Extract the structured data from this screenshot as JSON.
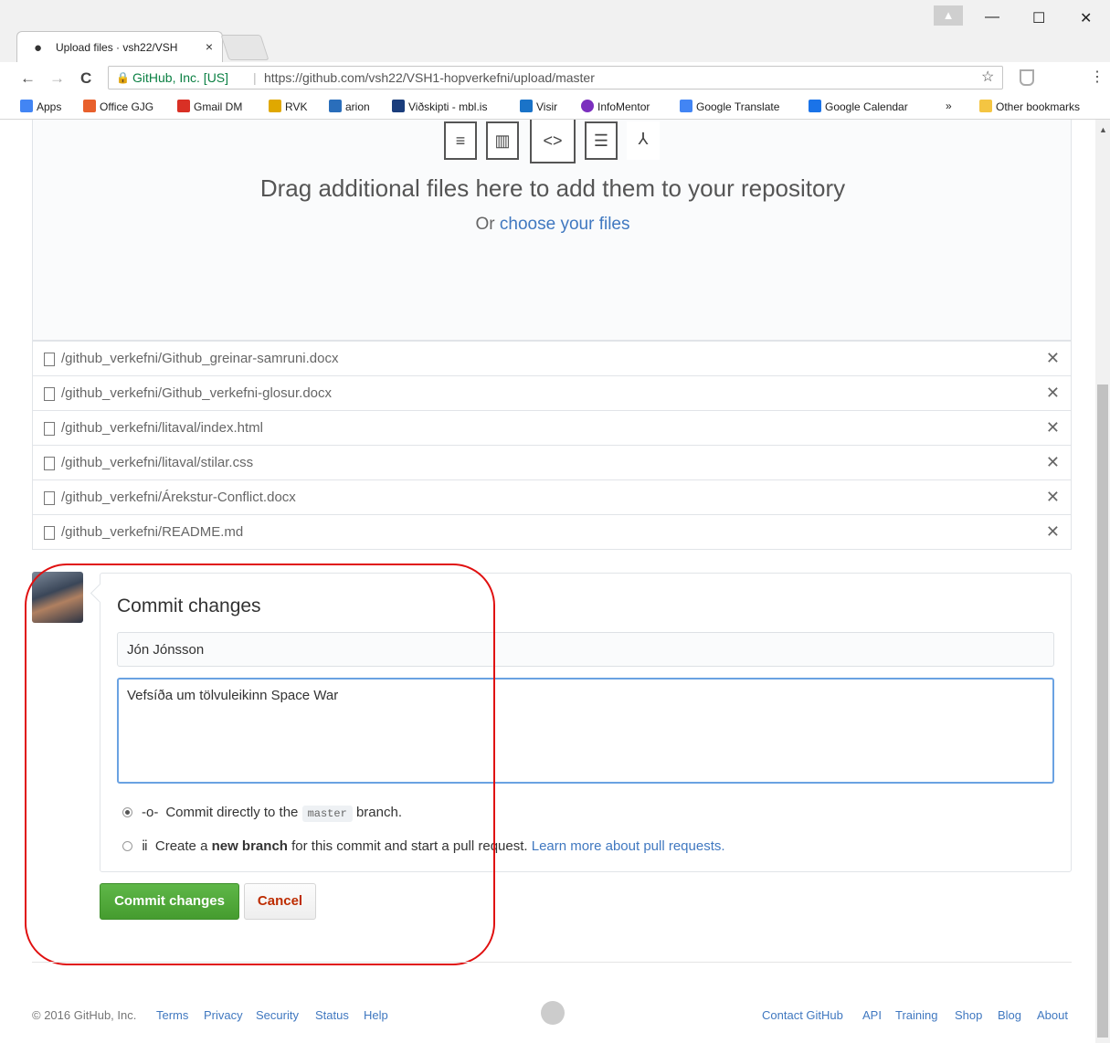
{
  "browser": {
    "tab_title": "Upload files · vsh22/VSH",
    "tab_close": "×",
    "org_label": "GitHub, Inc. [US]",
    "url": "https://github.com/vsh22/VSH1-hopverkefni/upload/master",
    "window_minimize": "—",
    "window_maximize": "☐",
    "window_close": "✕",
    "back": "←",
    "forward": "→",
    "reload": "C",
    "star": "☆",
    "menu": "⋮"
  },
  "bookmarks": {
    "items": [
      {
        "label": "Apps",
        "color": "#4285f4"
      },
      {
        "label": "Office GJG",
        "color": "#e8602c"
      },
      {
        "label": "Gmail DM",
        "color": "#d93025"
      },
      {
        "label": "RVK",
        "color": "#e0a800"
      },
      {
        "label": "arion",
        "color": "#2a6ebb"
      },
      {
        "label": "Viðskipti - mbl.is",
        "color": "#1a3d7c"
      },
      {
        "label": "Visir",
        "color": "#1a73c8"
      },
      {
        "label": "InfoMentor",
        "color": "#7b2fbe"
      },
      {
        "label": "Google Translate",
        "color": "#4285f4"
      },
      {
        "label": "Google Calendar",
        "color": "#1a73e8"
      }
    ],
    "overflow": "»",
    "other": "Other bookmarks"
  },
  "upload": {
    "drag_title": "Drag additional files here to add them to your repository",
    "or_text": "Or",
    "choose_link": "choose your files",
    "files": [
      "/github_verkefni/Github_greinar-samruni.docx",
      "/github_verkefni/Github_verkefni-glosur.docx",
      "/github_verkefni/litaval/index.html",
      "/github_verkefni/litaval/stilar.css",
      "/github_verkefni/Árekstur-Conflict.docx",
      "/github_verkefni/README.md"
    ],
    "remove_glyph": "✕"
  },
  "commit": {
    "title": "Commit changes",
    "summary_value": "Jón Jónsson",
    "description_value": "Vefsíða um tölvuleikinn Space War",
    "option_direct_prefix": "Commit directly to the",
    "branch_name": "master",
    "option_direct_suffix": "branch.",
    "option_new_prefix": "Create a",
    "option_new_bold": "new branch",
    "option_new_suffix": "for this commit and start a pull request.",
    "learn_more": "Learn more about pull requests.",
    "commit_button": "Commit changes",
    "cancel_button": "Cancel"
  },
  "footer": {
    "copyright": "© 2016 GitHub, Inc.",
    "left_links": [
      "Terms",
      "Privacy",
      "Security",
      "Status",
      "Help"
    ],
    "right_links": [
      "Contact GitHub",
      "API",
      "Training",
      "Shop",
      "Blog",
      "About"
    ]
  }
}
